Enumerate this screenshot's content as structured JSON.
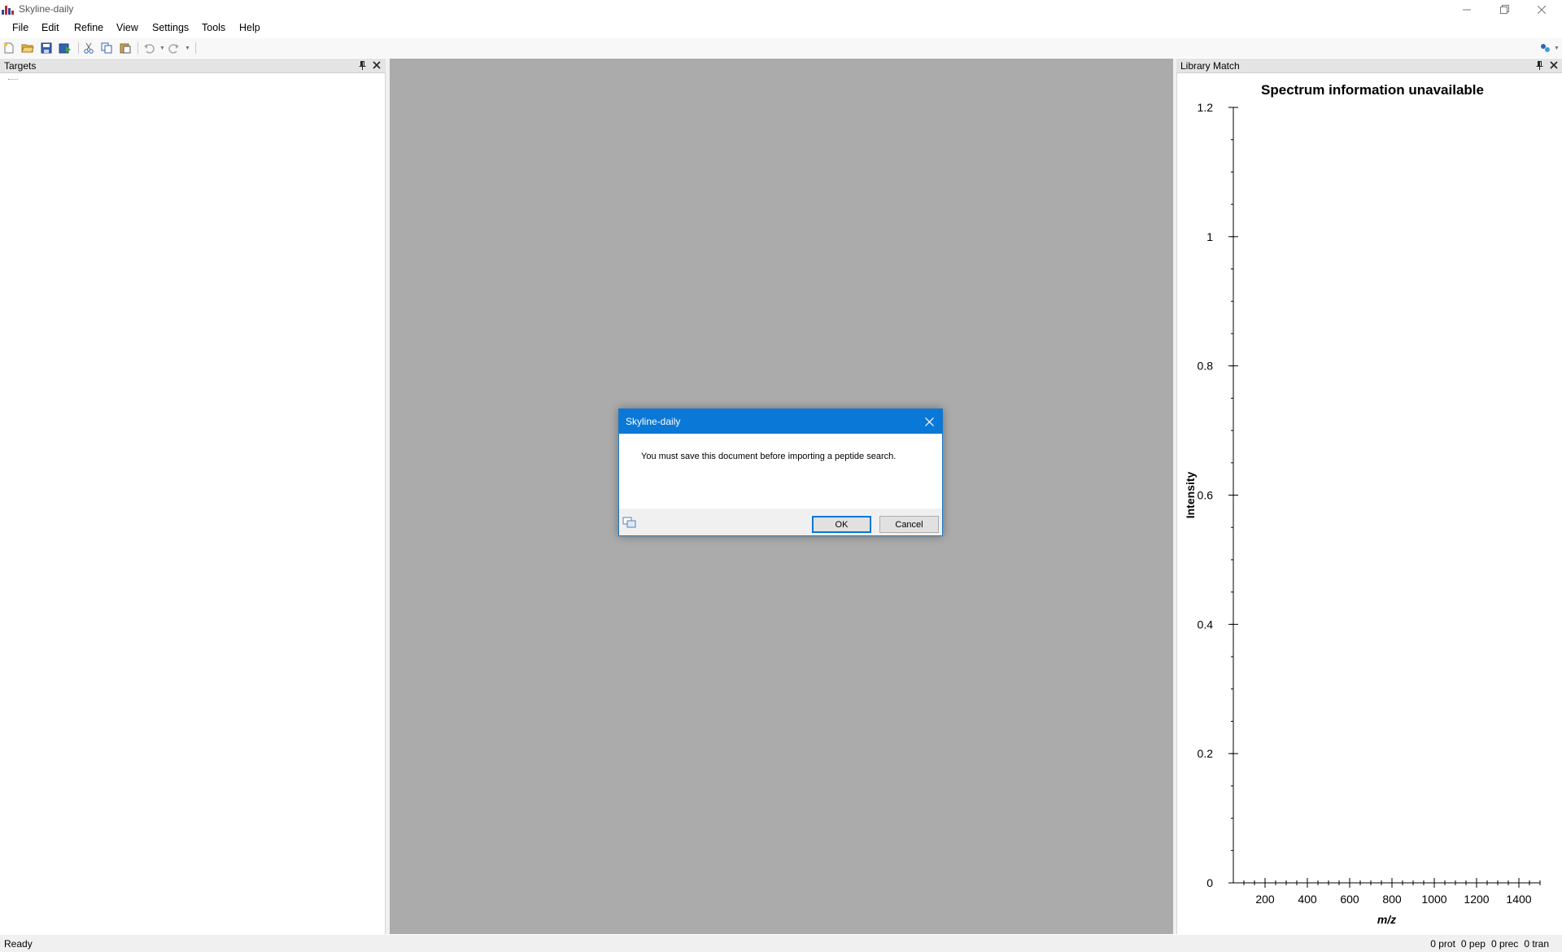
{
  "window": {
    "title": "Skyline-daily"
  },
  "menu": [
    "File",
    "Edit",
    "Refine",
    "View",
    "Settings",
    "Tools",
    "Help"
  ],
  "panes": {
    "targets": {
      "title": "Targets"
    },
    "library_match": {
      "title": "Library Match"
    }
  },
  "chart_data": {
    "type": "line",
    "title": "Spectrum information unavailable",
    "xlabel": "m/z",
    "ylabel": "Intensity",
    "xlim": [
      50,
      1500
    ],
    "ylim": [
      0,
      1.2
    ],
    "x_ticks": [
      "200",
      "400",
      "600",
      "800",
      "1000",
      "1200",
      "1400"
    ],
    "y_ticks": [
      "0",
      "0.2",
      "0.4",
      "0.6",
      "0.8",
      "1",
      "1.2"
    ],
    "series": []
  },
  "dialog": {
    "title": "Skyline-daily",
    "message": "You must save this document before importing a peptide search.",
    "ok_label": "OK",
    "cancel_label": "Cancel"
  },
  "status": {
    "left": "Ready",
    "counts": [
      "0 prot",
      "0 pep",
      "0 prec",
      "0 tran"
    ]
  },
  "colors": {
    "accent": "#0a78d7",
    "document_background": "#ababab"
  }
}
